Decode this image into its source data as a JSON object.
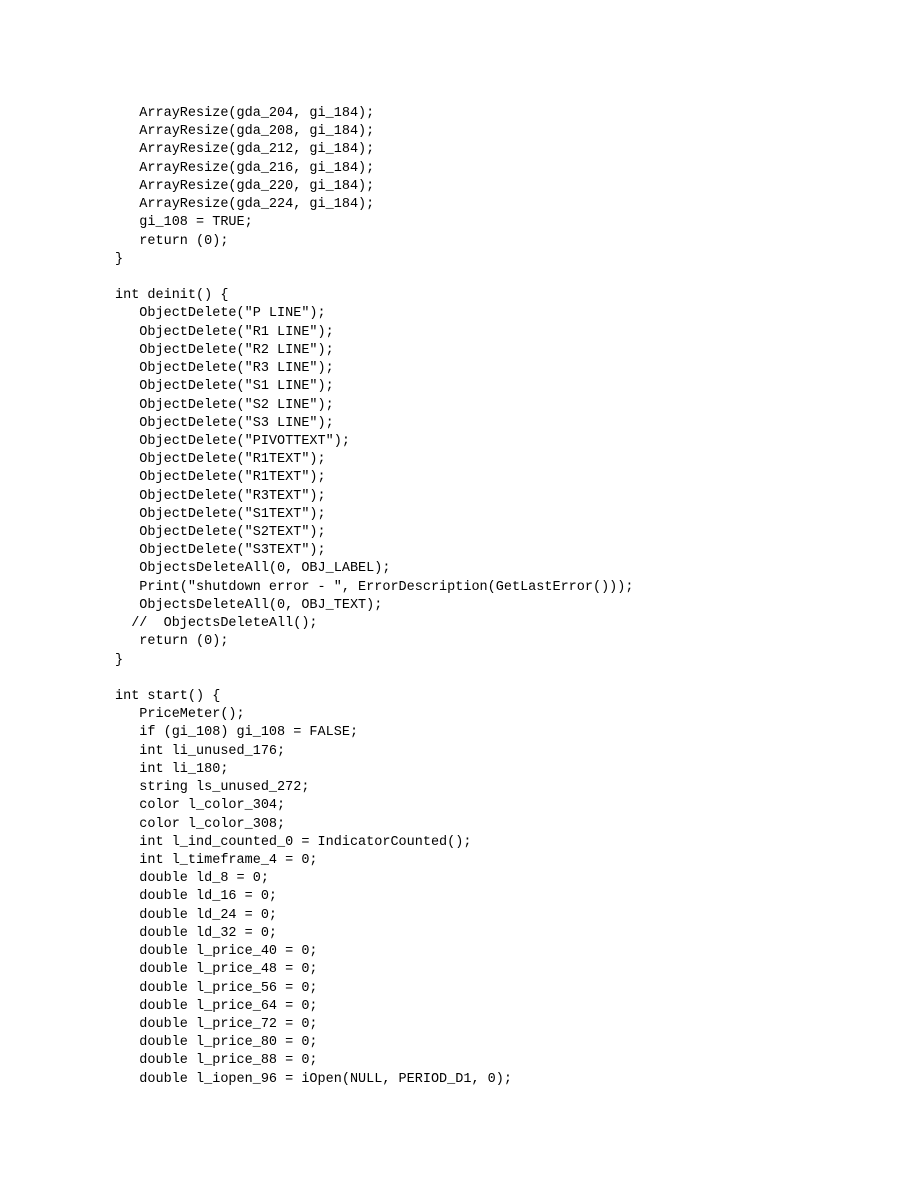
{
  "code": "   ArrayResize(gda_204, gi_184);\n   ArrayResize(gda_208, gi_184);\n   ArrayResize(gda_212, gi_184);\n   ArrayResize(gda_216, gi_184);\n   ArrayResize(gda_220, gi_184);\n   ArrayResize(gda_224, gi_184);\n   gi_108 = TRUE;\n   return (0);\n}\n\nint deinit() {\n   ObjectDelete(\"P LINE\");\n   ObjectDelete(\"R1 LINE\");\n   ObjectDelete(\"R2 LINE\");\n   ObjectDelete(\"R3 LINE\");\n   ObjectDelete(\"S1 LINE\");\n   ObjectDelete(\"S2 LINE\");\n   ObjectDelete(\"S3 LINE\");\n   ObjectDelete(\"PIVOTTEXT\");\n   ObjectDelete(\"R1TEXT\");\n   ObjectDelete(\"R1TEXT\");\n   ObjectDelete(\"R3TEXT\");\n   ObjectDelete(\"S1TEXT\");\n   ObjectDelete(\"S2TEXT\");\n   ObjectDelete(\"S3TEXT\");\n   ObjectsDeleteAll(0, OBJ_LABEL);\n   Print(\"shutdown error - \", ErrorDescription(GetLastError()));\n   ObjectsDeleteAll(0, OBJ_TEXT);\n  //  ObjectsDeleteAll();\n   return (0);\n}\n\nint start() {\n   PriceMeter();\n   if (gi_108) gi_108 = FALSE;\n   int li_unused_176;\n   int li_180;\n   string ls_unused_272;\n   color l_color_304;\n   color l_color_308;\n   int l_ind_counted_0 = IndicatorCounted();\n   int l_timeframe_4 = 0;\n   double ld_8 = 0;\n   double ld_16 = 0;\n   double ld_24 = 0;\n   double ld_32 = 0;\n   double l_price_40 = 0;\n   double l_price_48 = 0;\n   double l_price_56 = 0;\n   double l_price_64 = 0;\n   double l_price_72 = 0;\n   double l_price_80 = 0;\n   double l_price_88 = 0;\n   double l_iopen_96 = iOpen(NULL, PERIOD_D1, 0);"
}
